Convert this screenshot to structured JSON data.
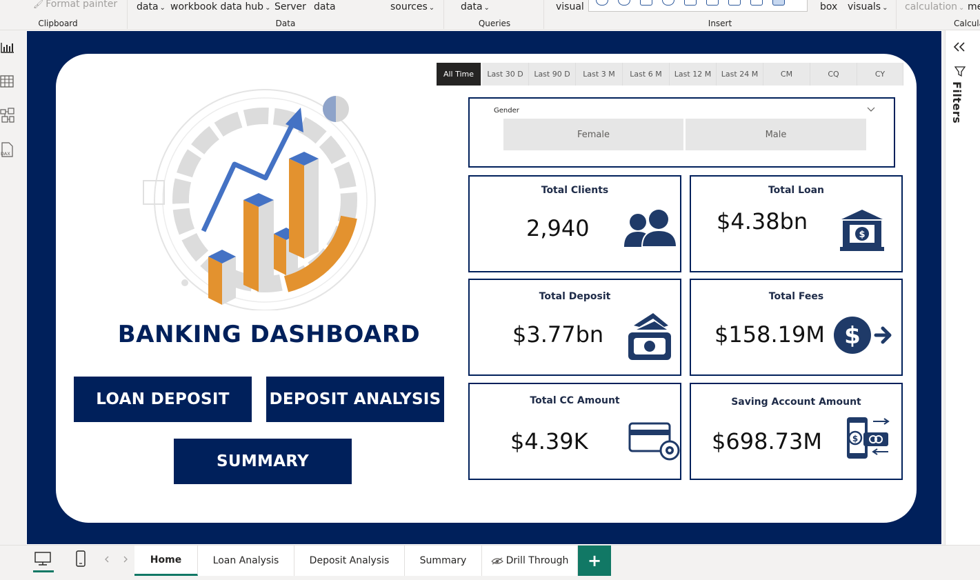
{
  "ribbon": {
    "format_painter": "Format painter",
    "data1": "data",
    "workbook_hub": "workbook data hub",
    "server": "Server",
    "data2": "data",
    "sources": "sources",
    "data3": "data",
    "visual": "visual",
    "box": "box",
    "visuals": "visuals",
    "calculation": "calculation",
    "me": "me",
    "groups": {
      "clipboard": "Clipboard",
      "data": "Data",
      "queries": "Queries",
      "insert": "Insert",
      "calcula": "Calcula"
    }
  },
  "left_rail": {
    "icons": [
      "report-view-icon",
      "table-view-icon",
      "model-view-icon",
      "dax-query-icon"
    ]
  },
  "right_pane": {
    "filters_label": "Filters"
  },
  "date_tabs": [
    "All Time",
    "Last 30 D",
    "Last 90 D",
    "Last 3 M",
    "Last 6 M",
    "Last 12 M",
    "Last 24 M",
    "CM",
    "CQ",
    "CY"
  ],
  "gender_slicer": {
    "title": "Gender",
    "options": [
      "Female",
      "Male"
    ]
  },
  "kpis": {
    "total_clients": {
      "title": "Total Clients",
      "value": "2,940"
    },
    "total_loan": {
      "title": "Total Loan",
      "value": "$4.38bn"
    },
    "total_deposit": {
      "title": "Total Deposit",
      "value": "$3.77bn"
    },
    "total_fees": {
      "title": "Total Fees",
      "value": "$158.19M"
    },
    "total_cc": {
      "title": "Total CC Amount",
      "value": "$4.39K"
    },
    "saving": {
      "title": "Saving Account Amount",
      "value": "$698.73M"
    }
  },
  "dashboard_title": "BANKING DASHBOARD",
  "nav_buttons": {
    "loan_deposit": "LOAN DEPOSIT",
    "deposit_analysis": "DEPOSIT ANALYSIS",
    "summary": "SUMMARY"
  },
  "page_tabs": [
    "Home",
    "Loan Analysis",
    "Deposit Analysis",
    "Summary",
    "Drill Through"
  ],
  "add_page": "+",
  "colors": {
    "navy": "#00205b",
    "orange": "#e3922f",
    "blue": "#4472c4",
    "teal": "#117865"
  }
}
